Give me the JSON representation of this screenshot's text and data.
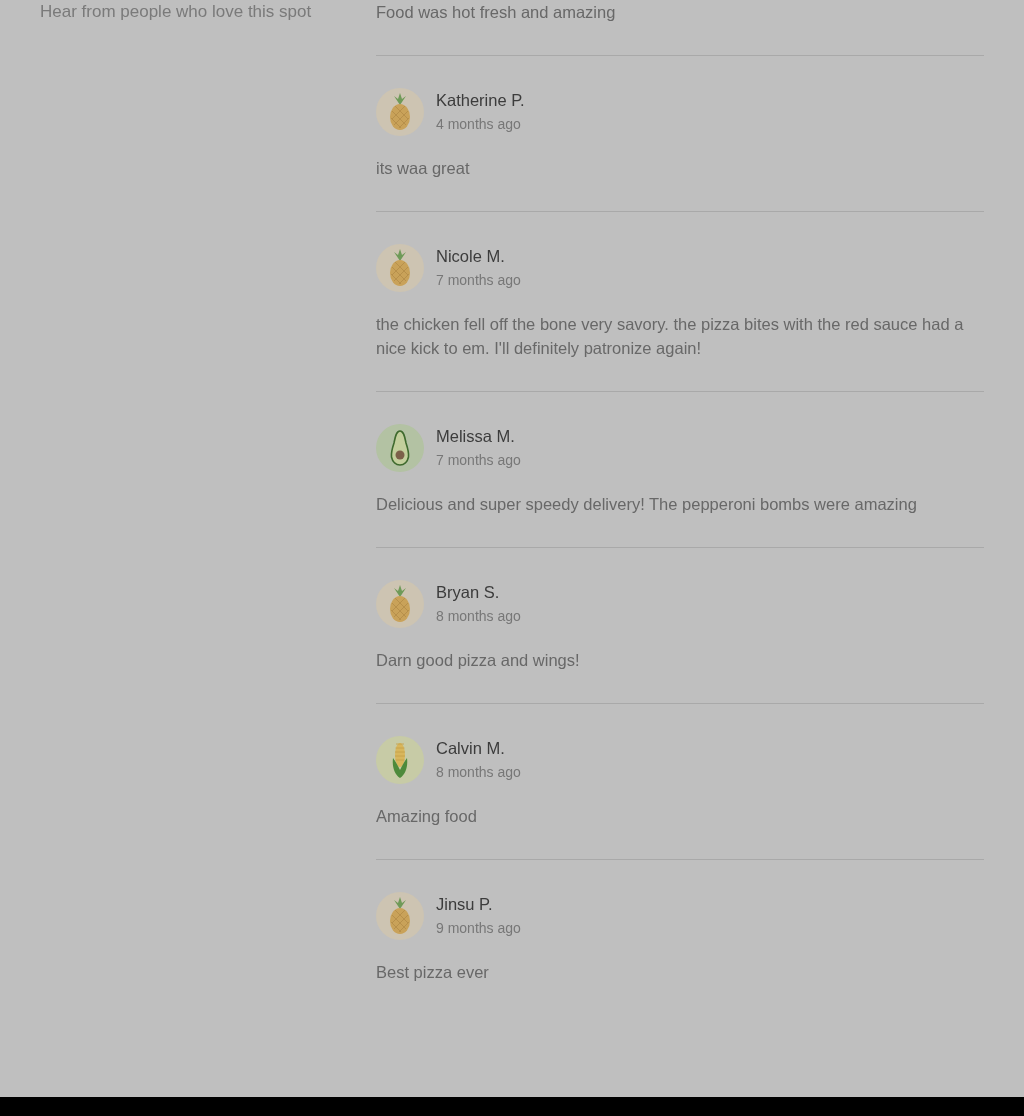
{
  "sidebar": {
    "subtitle": "Hear from people who love this spot"
  },
  "reviews": [
    {
      "text": "Food was hot fresh and amazing"
    },
    {
      "author": "Katherine P.",
      "time": "4 months ago",
      "avatar": {
        "kind": "pineapple"
      },
      "text": "its waa great"
    },
    {
      "author": "Nicole M.",
      "time": "7 months ago",
      "avatar": {
        "kind": "pineapple"
      },
      "text": "the chicken fell off the bone very savory. the pizza bites with the red sauce had a nice kick to em. I'll definitely patronize again!"
    },
    {
      "author": "Melissa M.",
      "time": "7 months ago",
      "avatar": {
        "kind": "avocado"
      },
      "text": "Delicious and super speedy delivery! The pepperoni bombs were amazing"
    },
    {
      "author": "Bryan S.",
      "time": "8 months ago",
      "avatar": {
        "kind": "pineapple"
      },
      "text": "Darn good pizza and wings!"
    },
    {
      "author": "Calvin M.",
      "time": "8 months ago",
      "avatar": {
        "kind": "corn"
      },
      "text": "Amazing food"
    },
    {
      "author": "Jinsu P.",
      "time": "9 months ago",
      "avatar": {
        "kind": "pineapple"
      },
      "text": "Best pizza ever"
    }
  ]
}
